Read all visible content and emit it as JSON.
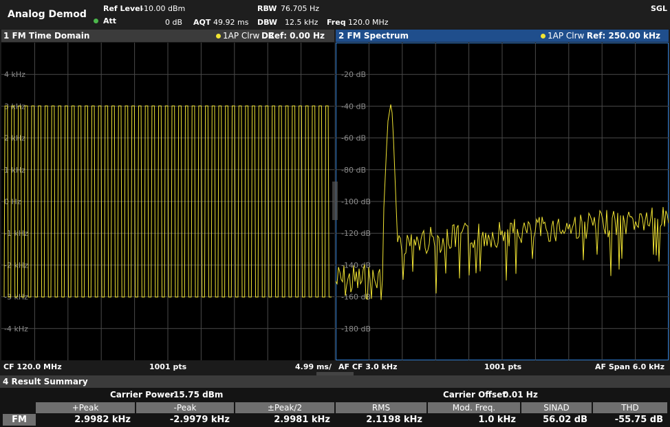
{
  "header": {
    "app_title": "Analog Demod",
    "ref_level_label": "Ref Level",
    "ref_level_value": "-10.00 dBm",
    "att_label": "Att",
    "att_value": "0 dB",
    "aqt_label": "AQT",
    "aqt_value": "49.92 ms",
    "rbw_label": "RBW",
    "rbw_value": "76.705 Hz",
    "dbw_label": "DBW",
    "dbw_value": "12.5 kHz",
    "freq_label": "Freq",
    "freq_value": "120.0 MHz",
    "sweep_mode": "SGL",
    "att_indicator_color": "#4cb84c"
  },
  "panel1": {
    "title": "1 FM Time Domain",
    "trace_mode": "1AP Clrw",
    "coupling": "DC",
    "ref": "Ref: 0.00 Hz",
    "y_labels": [
      "4 kHz",
      "3 kHz",
      "2 kHz",
      "1 kHz",
      "0 Hz",
      "-1 kHz",
      "-2 kHz",
      "-3 kHz",
      "-4 kHz"
    ],
    "footer_left": "CF 120.0 MHz",
    "footer_mid": "1001 pts",
    "footer_right": "4.99 ms/"
  },
  "panel2": {
    "title": "2 FM Spectrum",
    "trace_mode": "1AP Clrw",
    "ref": "Ref: 250.00 kHz",
    "y_labels": [
      "-20 dB",
      "-40 dB",
      "-60 dB",
      "-80 dB",
      "-100 dB",
      "-120 dB",
      "-140 dB",
      "-160 dB",
      "-180 dB"
    ],
    "footer_left": "AF CF 3.0 kHz",
    "footer_mid": "1001 pts",
    "footer_right": "AF Span 6.0 kHz"
  },
  "trace_color": "#f2e533",
  "active_panel_color": "#2f7fd6",
  "summary": {
    "title": "4 Result Summary",
    "carrier_power_label": "Carrier Power",
    "carrier_power_value": "-15.75 dBm",
    "carrier_offset_label": "Carrier Offset",
    "carrier_offset_value": "0.01 Hz",
    "row_label": "FM",
    "columns": [
      {
        "header": "+Peak",
        "value": "2.9982 kHz"
      },
      {
        "header": "-Peak",
        "value": "-2.9979 kHz"
      },
      {
        "header": "±Peak/2",
        "value": "2.9981 kHz"
      },
      {
        "header": "RMS",
        "value": "2.1198 kHz"
      },
      {
        "header": "Mod. Freq.",
        "value": "1.0 kHz"
      },
      {
        "header": "SINAD",
        "value": "56.02 dB"
      },
      {
        "header": "THD",
        "value": "-55.75 dB"
      }
    ]
  }
}
